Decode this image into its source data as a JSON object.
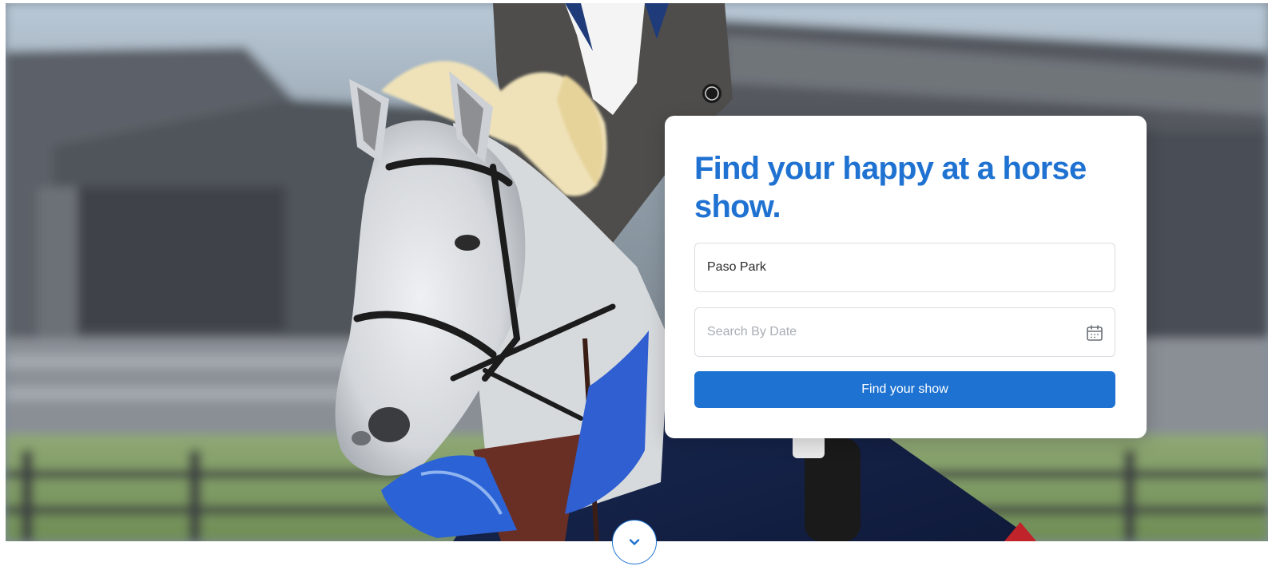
{
  "hero": {
    "image_subject": "grey horse with rider and blue ribbon at show arena"
  },
  "search_card": {
    "title": "Find your happy at a horse show.",
    "location_field": {
      "value": "Paso Park",
      "placeholder": ""
    },
    "date_field": {
      "value": "",
      "placeholder": "Search By Date",
      "icon": "calendar-icon"
    },
    "submit_label": "Find your show"
  },
  "scroll_button": {
    "icon": "chevron-down-icon"
  },
  "colors": {
    "accent": "#1f72d1",
    "button": "#1d72d2",
    "placeholder": "#a8adb3",
    "card_background": "#ffffff"
  }
}
